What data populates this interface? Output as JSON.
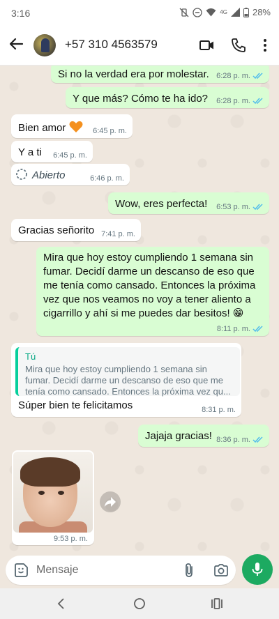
{
  "status": {
    "time": "3:16",
    "network": "4G",
    "battery": "28%"
  },
  "contact": {
    "name": "+57 310 4563579"
  },
  "messages": [
    {
      "dir": "out",
      "text": "Si no la verdad era por molestar.",
      "time": "6:28 p. m."
    },
    {
      "dir": "out",
      "text": "Y que más? Cómo te ha ido?",
      "time": "6:28 p. m."
    },
    {
      "dir": "in",
      "text": "Bien amor",
      "time": "6:45 p. m."
    },
    {
      "dir": "in",
      "text": "Y a ti",
      "time": "6:45 p. m."
    },
    {
      "dir": "in",
      "text": "Abierto",
      "time": "6:46 p. m."
    },
    {
      "dir": "out",
      "text": "Wow, eres perfecta!",
      "time": "6:53 p. m."
    },
    {
      "dir": "in",
      "text": "Gracias señorito",
      "time": "7:41 p. m."
    },
    {
      "dir": "out",
      "lines": [
        "Mira que hoy estoy cumpliendo 1 semana sin",
        "fumar. Decidí darme un descanso de eso que",
        "me tenía como cansado. Entonces la próxima",
        "vez que nos veamos no voy a tener aliento a",
        "cigarrillo y ahí si me puedes dar besitos! 😁"
      ],
      "time": "8:11 p. m."
    },
    {
      "dir": "in",
      "quote": {
        "author": "Tú",
        "lines": [
          "Mira que hoy estoy cumpliendo 1 semana sin",
          "fumar. Decidí darme un descanso de eso que me",
          "tenía como cansado. Entonces la próxima vez qu..."
        ]
      },
      "text": "Súper bien te felicitamos",
      "time": "8:31 p. m."
    },
    {
      "dir": "out",
      "text": "Jajaja gracias!",
      "time": "8:36 p. m."
    },
    {
      "dir": "in",
      "type": "image",
      "time": "9:53 p. m."
    }
  ],
  "compose": {
    "placeholder": "Mensaje"
  },
  "colors": {
    "accent": "#1daa61",
    "outgoing_bubble": "#d9fdd3",
    "incoming_bubble": "#ffffff",
    "read_ticks": "#53bdeb"
  }
}
